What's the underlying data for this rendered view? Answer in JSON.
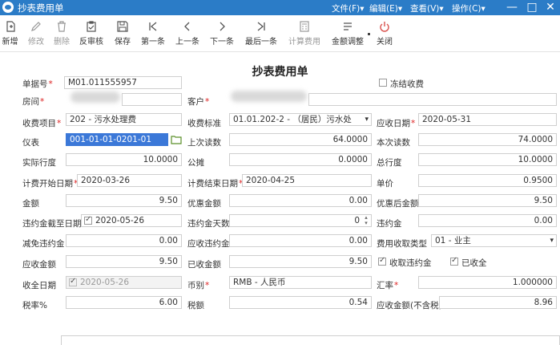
{
  "window": {
    "title": "抄表费用单",
    "menus": [
      "文件(F)▾",
      "编辑(E)▾",
      "查看(V)▾",
      "操作(C)▾"
    ],
    "controls": [
      "—",
      "□",
      "✕"
    ]
  },
  "toolbar": {
    "new": "新增",
    "edit": "修改",
    "delete": "删除",
    "unapprove": "反审核",
    "save": "保存",
    "first": "第一条",
    "prev": "上一条",
    "next": "下一条",
    "last": "最后一条",
    "calc": "计算费用",
    "adjust": "金额调整",
    "close": "关闭"
  },
  "form": {
    "title": "抄表费用单",
    "doc_no": {
      "label": "单据号",
      "value": "M01.011555957"
    },
    "freeze": {
      "label": "冻结收费",
      "checked": false
    },
    "room": {
      "label": "房间"
    },
    "customer": {
      "label": "客户"
    },
    "fee_item": {
      "label": "收费项目",
      "value": "202 - 污水处理费"
    },
    "fee_standard": {
      "label": "收费标准",
      "value": "01.01.202-2 - （居民）污水处"
    },
    "due_date": {
      "label": "应收日期",
      "value": "2020-05-31"
    },
    "meter": {
      "label": "仪表",
      "value": "001-01-01-0201-01"
    },
    "last_reading": {
      "label": "上次读数",
      "value": "64.0000"
    },
    "this_reading": {
      "label": "本次读数",
      "value": "74.0000"
    },
    "actual_usage": {
      "label": "实际行度",
      "value": "10.0000"
    },
    "shared": {
      "label": "公摊",
      "value": "0.0000"
    },
    "total_usage": {
      "label": "总行度",
      "value": "10.0000"
    },
    "bill_start": {
      "label": "计费开始日期",
      "value": "2020-03-26"
    },
    "bill_end": {
      "label": "计费结束日期",
      "value": "2020-04-25"
    },
    "unit_price": {
      "label": "单价",
      "value": "0.9500"
    },
    "amount": {
      "label": "金额",
      "value": "9.50"
    },
    "discount": {
      "label": "优惠金额",
      "value": "0.00"
    },
    "after_discount": {
      "label": "优惠后金额",
      "value": "9.50"
    },
    "penalty_cutoff": {
      "label": "违约金截至日期",
      "value": "2020-05-26",
      "checked": true
    },
    "penalty_days": {
      "label": "违约金天数",
      "value": "0"
    },
    "penalty": {
      "label": "违约金",
      "value": "0.00"
    },
    "penalty_waive": {
      "label": "减免违约金",
      "value": "0.00"
    },
    "penalty_due": {
      "label": "应收违约金",
      "value": "0.00"
    },
    "fee_collect_type": {
      "label": "费用收取类型",
      "value": "01 - 业主"
    },
    "receivable": {
      "label": "应收金额",
      "value": "9.50"
    },
    "received": {
      "label": "已收金额",
      "value": "9.50"
    },
    "collect_penalty": {
      "label": "收取违约金",
      "checked": true
    },
    "collected": {
      "label": "已收全",
      "checked": true
    },
    "collect_date": {
      "label": "收全日期",
      "value": "2020-05-26",
      "checked": true
    },
    "currency": {
      "label": "币别",
      "value": "RMB - 人民币"
    },
    "rate": {
      "label": "汇率",
      "value": "1.000000"
    },
    "tax_rate": {
      "label": "税率%",
      "value": "6.00"
    },
    "tax": {
      "label": "税额",
      "value": "0.54"
    },
    "net_receivable": {
      "label": "应收金额(不含税)",
      "value": "8.96"
    }
  },
  "colors": {
    "titlebar": "#2b7cc7",
    "required": "#d22222",
    "highlight": "#3b78d8"
  },
  "icons": {
    "new": "new-doc-icon",
    "edit": "pencil-icon",
    "delete": "trash-icon",
    "unapprove": "clipboard-icon",
    "save": "floppy-icon",
    "first": "first-icon",
    "prev": "prev-icon",
    "next": "next-icon",
    "last": "last-icon",
    "calc": "calculator-icon",
    "adjust": "adjust-icon",
    "close": "power-icon",
    "meter": "folder-icon"
  }
}
